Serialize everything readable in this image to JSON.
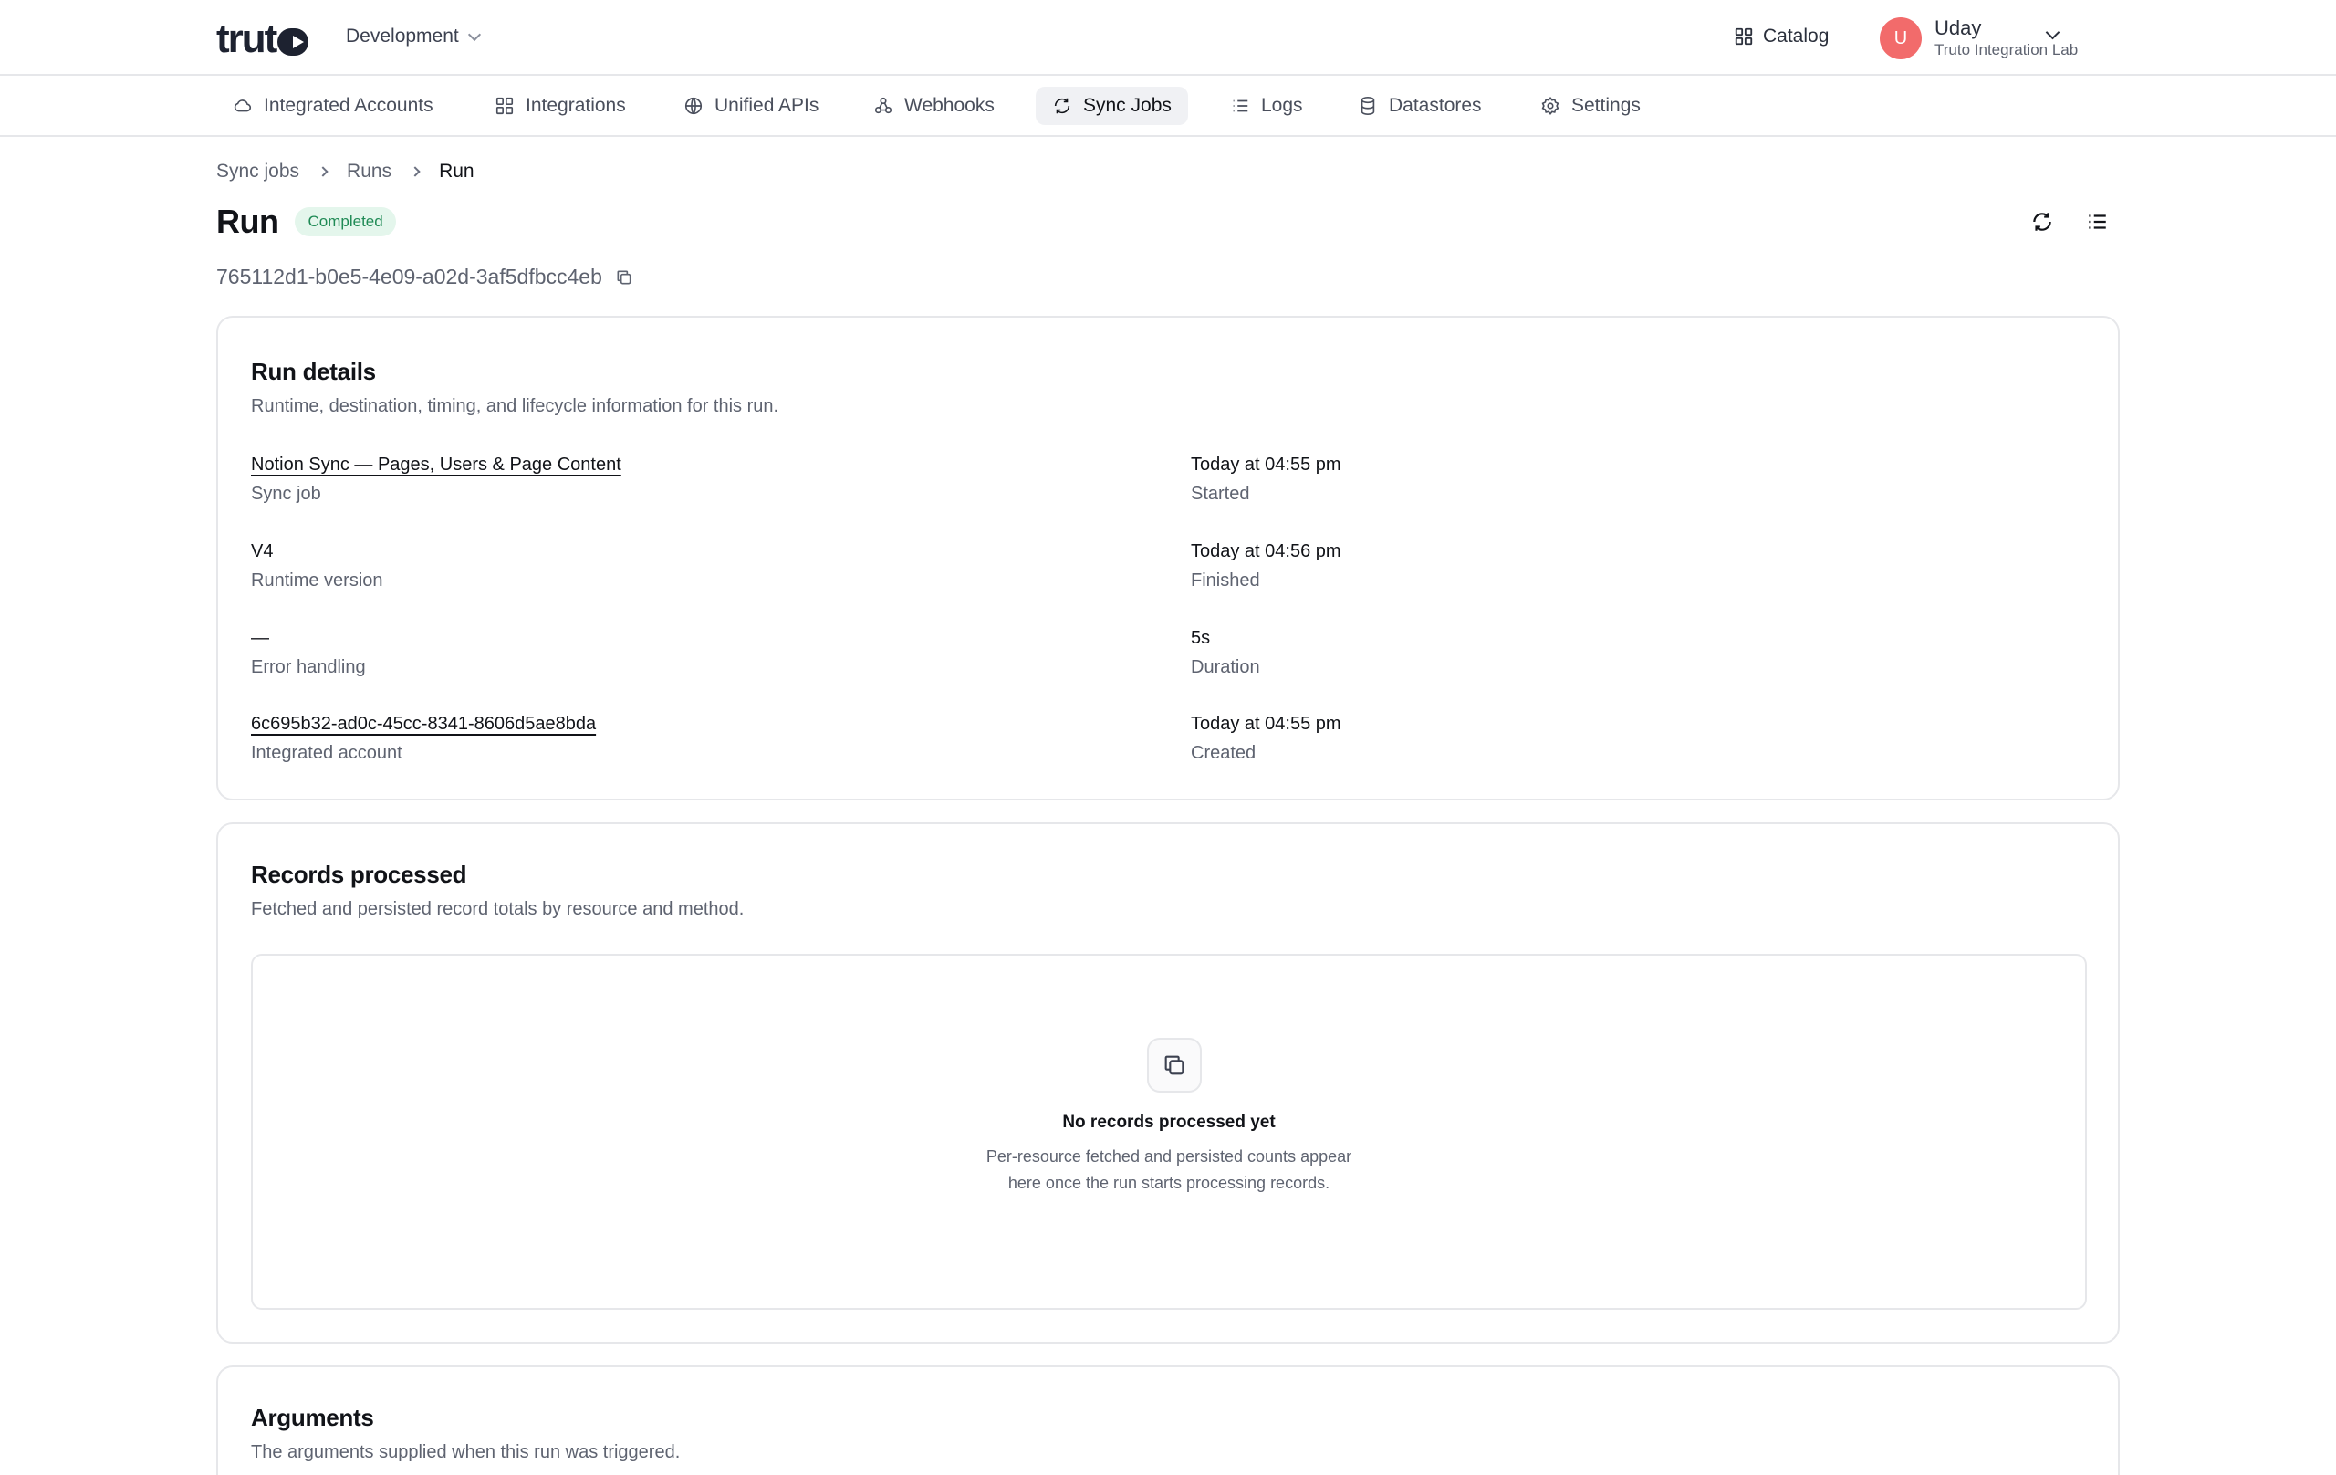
{
  "header": {
    "logo_text": "truto",
    "environment": "Development",
    "catalog_label": "Catalog",
    "user": {
      "initial": "U",
      "name": "Uday",
      "org": "Truto Integration Lab"
    }
  },
  "nav": {
    "items": [
      {
        "label": "Integrated Accounts",
        "icon": "cloud-icon"
      },
      {
        "label": "Integrations",
        "icon": "grid-icon"
      },
      {
        "label": "Unified APIs",
        "icon": "globe-icon"
      },
      {
        "label": "Webhooks",
        "icon": "webhook-icon"
      },
      {
        "label": "Sync Jobs",
        "icon": "sync-icon",
        "active": true
      },
      {
        "label": "Logs",
        "icon": "list-icon"
      },
      {
        "label": "Datastores",
        "icon": "database-icon"
      },
      {
        "label": "Settings",
        "icon": "gear-icon"
      }
    ]
  },
  "breadcrumb": [
    "Sync jobs",
    "Runs",
    "Run"
  ],
  "page": {
    "title": "Run",
    "status": "Completed",
    "run_id": "765112d1-b0e5-4e09-a02d-3af5dfbcc4eb"
  },
  "run_details": {
    "title": "Run details",
    "subtitle": "Runtime, destination, timing, and lifecycle information for this run.",
    "left": [
      {
        "value": "Notion Sync — Pages, Users & Page Content",
        "label": "Sync job"
      },
      {
        "value": "V4",
        "label": "Runtime version"
      },
      {
        "value": "—",
        "label": "Error handling"
      },
      {
        "value": "6c695b32-ad0c-45cc-8341-8606d5ae8bda",
        "label": "Integrated account"
      }
    ],
    "right": [
      {
        "value": "Today at 04:55 pm",
        "label": "Started"
      },
      {
        "value": "Today at 04:56 pm",
        "label": "Finished"
      },
      {
        "value": "5s",
        "label": "Duration"
      },
      {
        "value": "Today at 04:55 pm",
        "label": "Created"
      }
    ]
  },
  "records": {
    "title": "Records processed",
    "subtitle": "Fetched and persisted record totals by resource and method.",
    "empty_title": "No records processed yet",
    "empty_desc": "Per-resource fetched and persisted counts appear here once the run starts processing records."
  },
  "arguments": {
    "title": "Arguments",
    "subtitle": "The arguments supplied when this run was triggered."
  },
  "colors": {
    "accent_badge_bg": "#e4f6ec",
    "accent_badge_text": "#1f8a55",
    "avatar": "#f26b6b"
  }
}
